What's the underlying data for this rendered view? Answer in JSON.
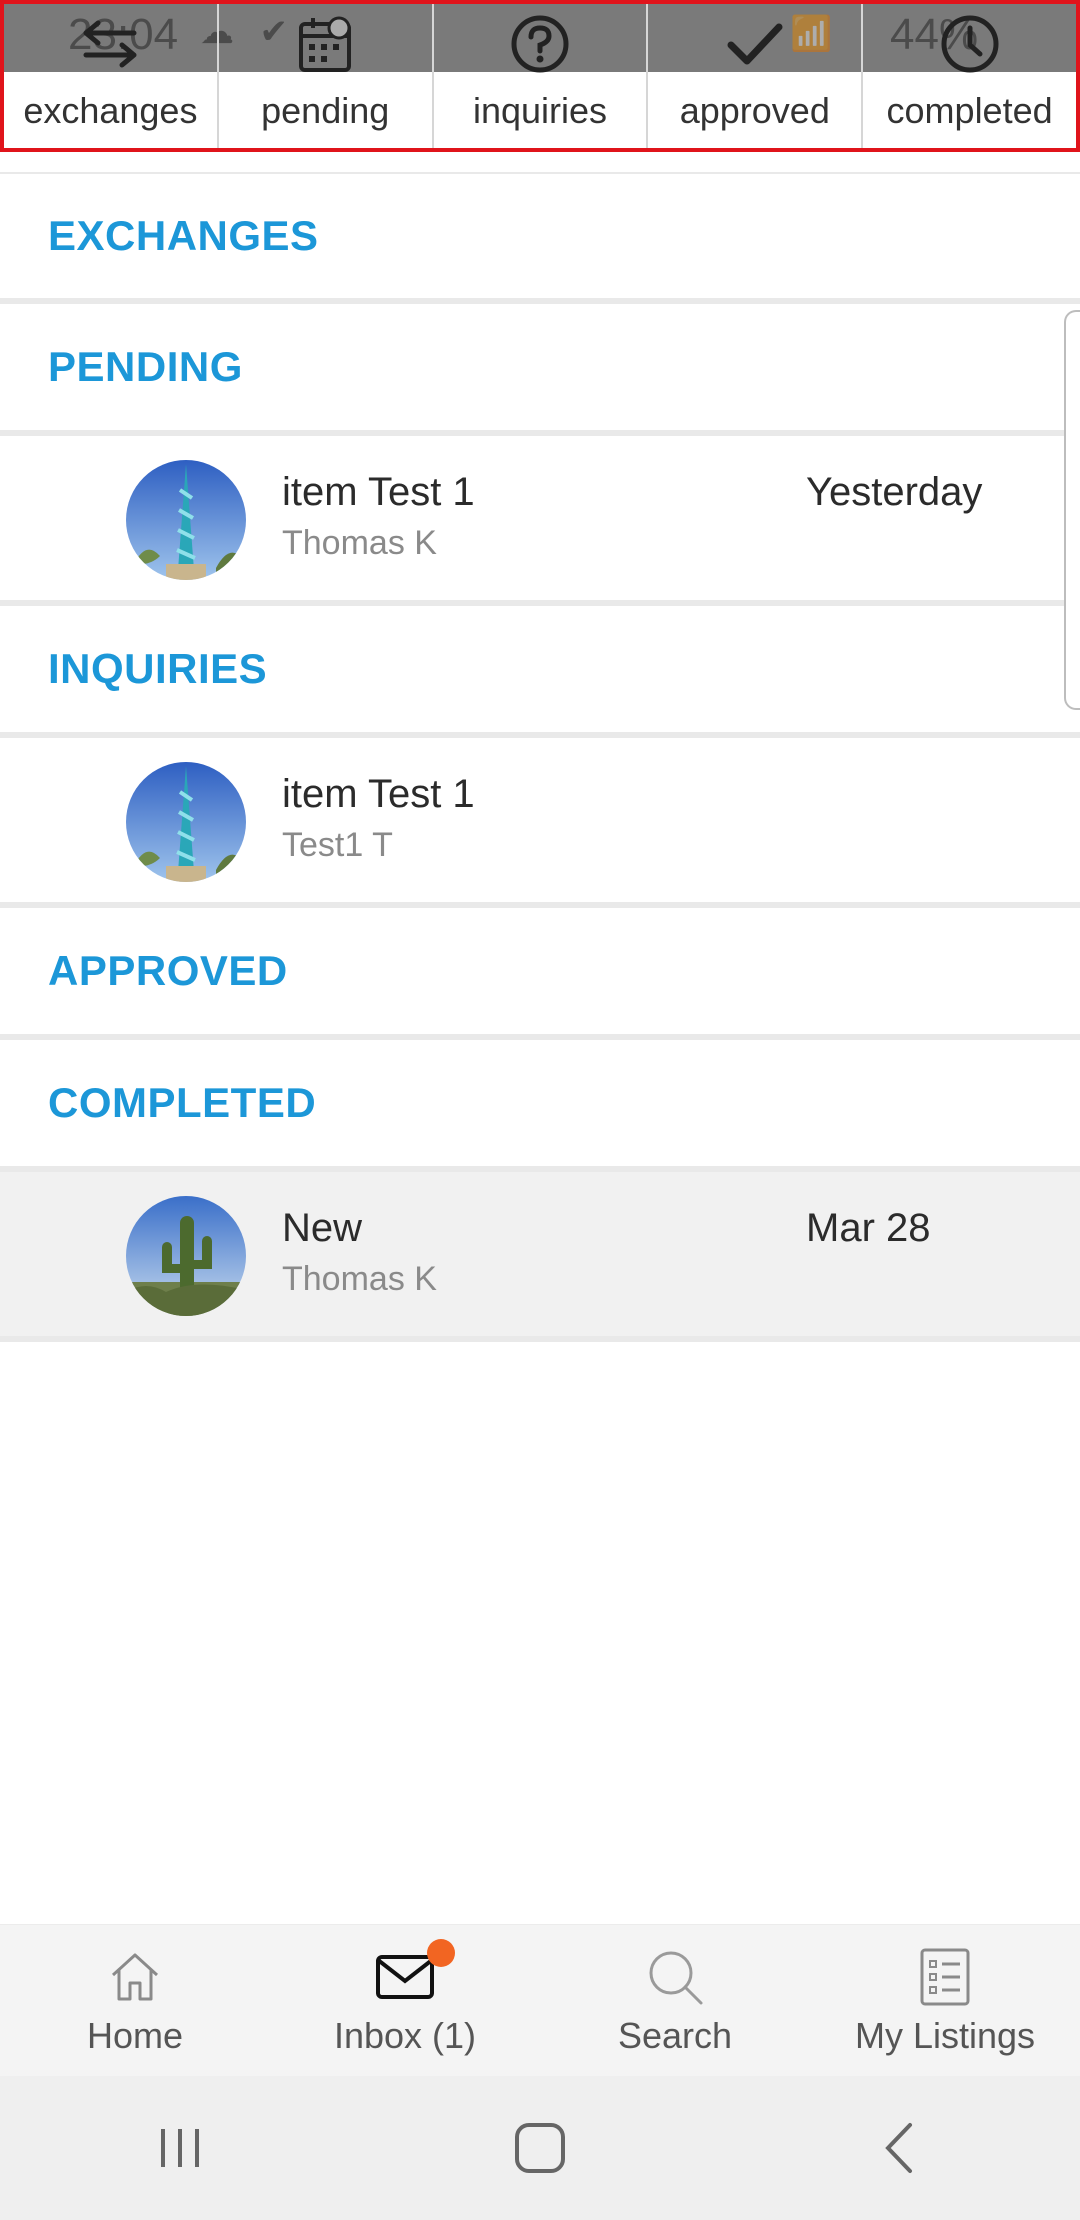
{
  "status_bar": {
    "time": "23:04",
    "battery": "44%"
  },
  "tabs": [
    {
      "label": "exchanges",
      "icon": "swap-arrows-icon"
    },
    {
      "label": "pending",
      "icon": "calendar-clock-icon"
    },
    {
      "label": "inquiries",
      "icon": "question-circle-icon"
    },
    {
      "label": "approved",
      "icon": "checkmark-icon"
    },
    {
      "label": "completed",
      "icon": "clock-icon"
    }
  ],
  "sections": {
    "exchanges": {
      "title": "EXCHANGES"
    },
    "pending": {
      "title": "PENDING",
      "items": [
        {
          "title": "item Test 1",
          "subtitle": "Thomas K",
          "date": "Yesterday"
        }
      ]
    },
    "inquiries": {
      "title": "INQUIRIES",
      "items": [
        {
          "title": "item Test 1",
          "subtitle": "Test1 T",
          "date": ""
        }
      ]
    },
    "approved": {
      "title": "APPROVED"
    },
    "completed": {
      "title": "COMPLETED",
      "items": [
        {
          "title": "New",
          "subtitle": "Thomas K",
          "date": "Mar 28"
        }
      ]
    }
  },
  "bottom_nav": [
    {
      "label": "Home",
      "icon": "home-icon"
    },
    {
      "label": "Inbox (1)",
      "icon": "envelope-icon"
    },
    {
      "label": "Search",
      "icon": "search-icon"
    },
    {
      "label": "My Listings",
      "icon": "list-icon"
    }
  ],
  "colors": {
    "section_header": "#1c97d8",
    "badge": "#f26522",
    "highlight_border": "#e0141b"
  }
}
